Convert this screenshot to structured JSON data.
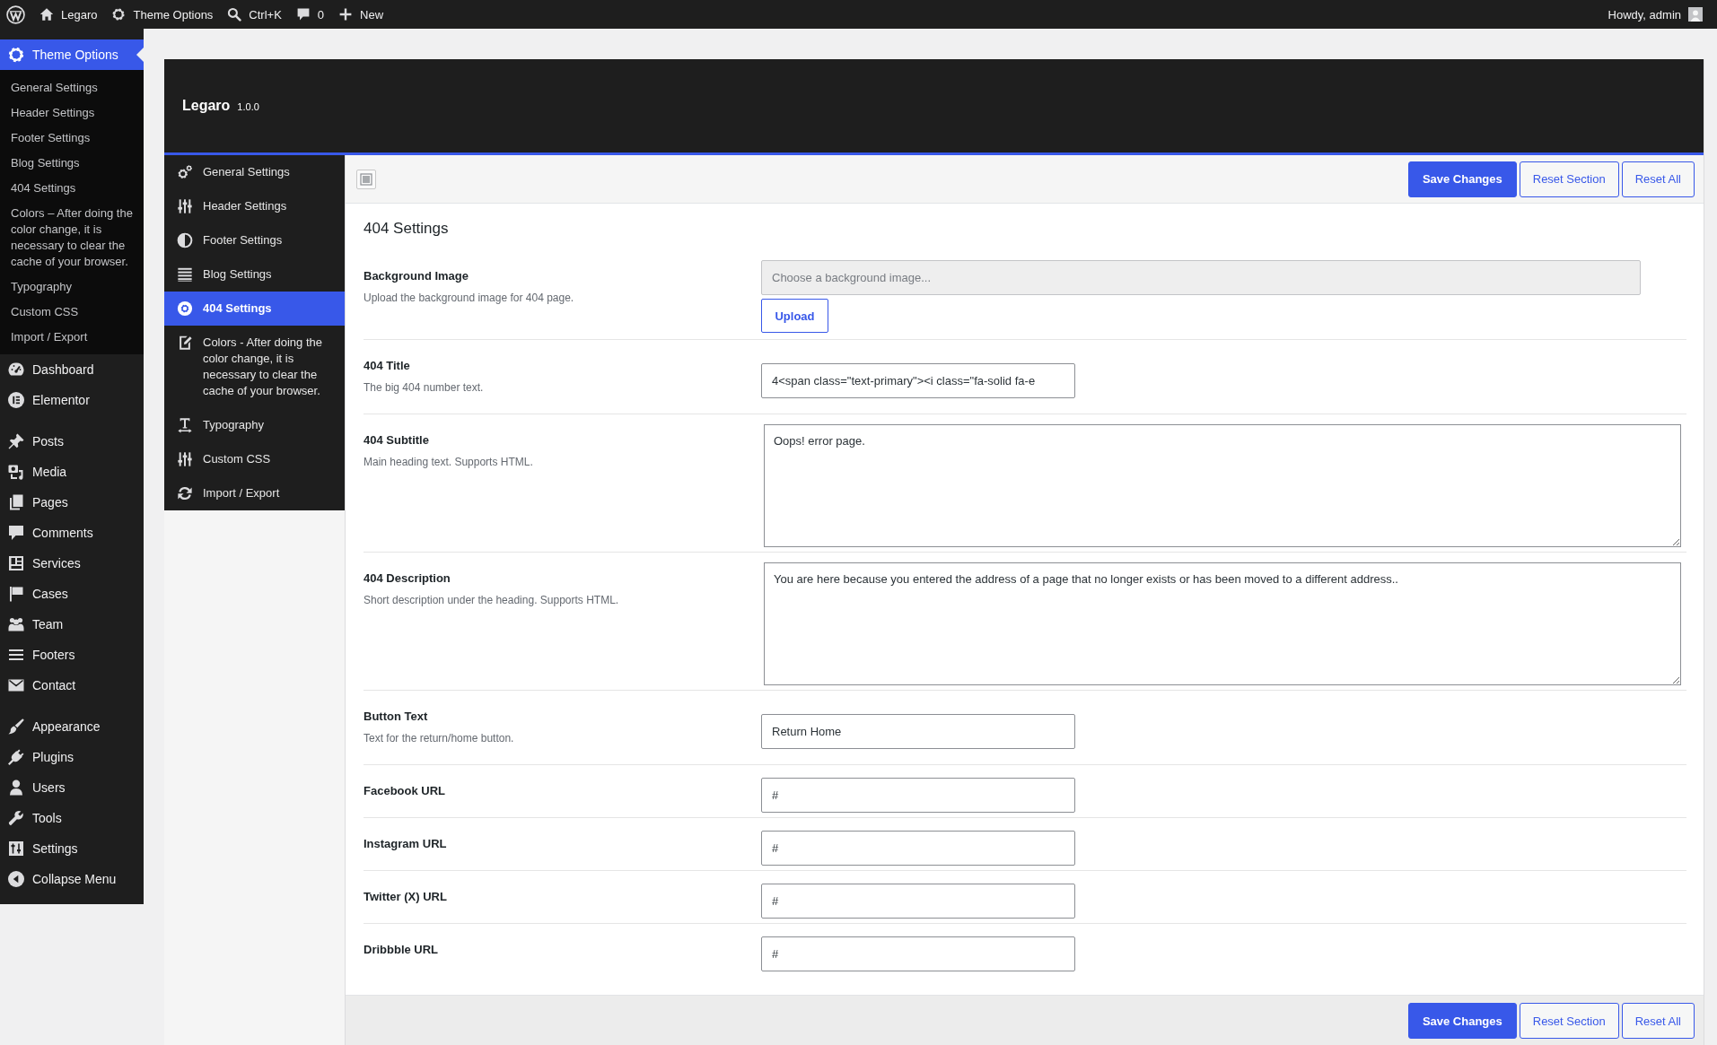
{
  "admin_bar": {
    "items": [
      {
        "label": "Legaro"
      },
      {
        "label": "Theme Options"
      },
      {
        "label": "Ctrl+K"
      },
      {
        "label": "0"
      },
      {
        "label": "New"
      }
    ],
    "account": "Howdy, admin"
  },
  "sidebar": {
    "menu_groups": [
      {
        "items": [
          {
            "label": "Theme Options",
            "selected": true,
            "submenu": [
              {
                "label": "General Settings",
                "selected": false
              },
              {
                "label": "Header Settings",
                "selected": false
              },
              {
                "label": "Footer Settings",
                "selected": false
              },
              {
                "label": "Blog Settings",
                "selected": false
              },
              {
                "label": "404 Settings",
                "selected": false
              },
              {
                "label": "Colors – After doing the color change, it is necessary to clear the cache of your browser.",
                "selected": false
              },
              {
                "label": "Typography",
                "selected": false
              },
              {
                "label": "Custom CSS",
                "selected": false
              },
              {
                "label": "Import / Export",
                "selected": false
              }
            ]
          },
          {
            "label": "Dashboard",
            "selected": false
          },
          {
            "label": "Elementor",
            "selected": false
          }
        ]
      },
      {
        "items": [
          {
            "label": "Posts",
            "selected": false
          },
          {
            "label": "Media",
            "selected": false
          },
          {
            "label": "Pages",
            "selected": false
          },
          {
            "label": "Comments",
            "selected": false
          },
          {
            "label": "Services",
            "selected": false
          },
          {
            "label": "Cases",
            "selected": false
          },
          {
            "label": "Team",
            "selected": false
          },
          {
            "label": "Footers",
            "selected": false
          },
          {
            "label": "Contact",
            "selected": false
          }
        ]
      },
      {
        "items": [
          {
            "label": "Appearance",
            "selected": false
          },
          {
            "label": "Plugins",
            "selected": false
          },
          {
            "label": "Users",
            "selected": false
          },
          {
            "label": "Tools",
            "selected": false
          },
          {
            "label": "Settings",
            "selected": false
          }
        ]
      }
    ],
    "collapse": "Collapse Menu"
  },
  "panel": {
    "brand": "Legaro",
    "version": "1.0.0",
    "sections": [
      {
        "label": "General Settings",
        "selected": false
      },
      {
        "label": "Header Settings",
        "selected": false
      },
      {
        "label": "Footer Settings",
        "selected": false
      },
      {
        "label": "Blog Settings",
        "selected": false
      },
      {
        "label": "404 Settings",
        "selected": true
      },
      {
        "label": "Colors - After doing the color change, it is necessary to clear the cache of your browser.",
        "selected": false
      },
      {
        "label": "Typography",
        "selected": false
      },
      {
        "label": "Custom CSS",
        "selected": false
      },
      {
        "label": "Import / Export",
        "selected": false
      }
    ],
    "toolbar_buttons": [
      {
        "label": "Save Changes",
        "kind": "primary"
      },
      {
        "label": "Reset Section",
        "kind": "secondary"
      },
      {
        "label": "Reset All",
        "kind": "secondary"
      }
    ],
    "section_title": "404 Settings",
    "fields": [
      {
        "kind": "upload",
        "label": "Background Image",
        "description": "Upload the background image for 404 page.",
        "placeholder": "Choose a background image...",
        "button": "Upload"
      },
      {
        "kind": "text",
        "label": "404 Title",
        "description": "The big 404 number text.",
        "value": "4<span class=\"text-primary\"><i class=\"fa-solid fa-e"
      },
      {
        "kind": "textarea",
        "label": "404 Subtitle",
        "description": "Main heading text. Supports HTML.",
        "value": "Oops! error page."
      },
      {
        "kind": "textarea",
        "label": "404 Description",
        "description": "Short description under the heading. Supports HTML.",
        "value": "You are here because you entered the address of a page that no longer exists or has been moved to a different address.."
      },
      {
        "kind": "text",
        "label": "Button Text",
        "description": "Text for the return/home button.",
        "value": "Return Home"
      },
      {
        "kind": "text",
        "label": "Facebook URL",
        "value": "#"
      },
      {
        "kind": "text",
        "label": "Instagram URL",
        "value": "#"
      },
      {
        "kind": "text",
        "label": "Twitter (X) URL",
        "value": "#"
      },
      {
        "kind": "text",
        "label": "Dribbble URL",
        "value": "#"
      }
    ],
    "footer_buttons": [
      {
        "label": "Save Changes",
        "kind": "primary"
      },
      {
        "label": "Reset Section",
        "kind": "secondary"
      },
      {
        "label": "Reset All",
        "kind": "secondary"
      }
    ]
  }
}
